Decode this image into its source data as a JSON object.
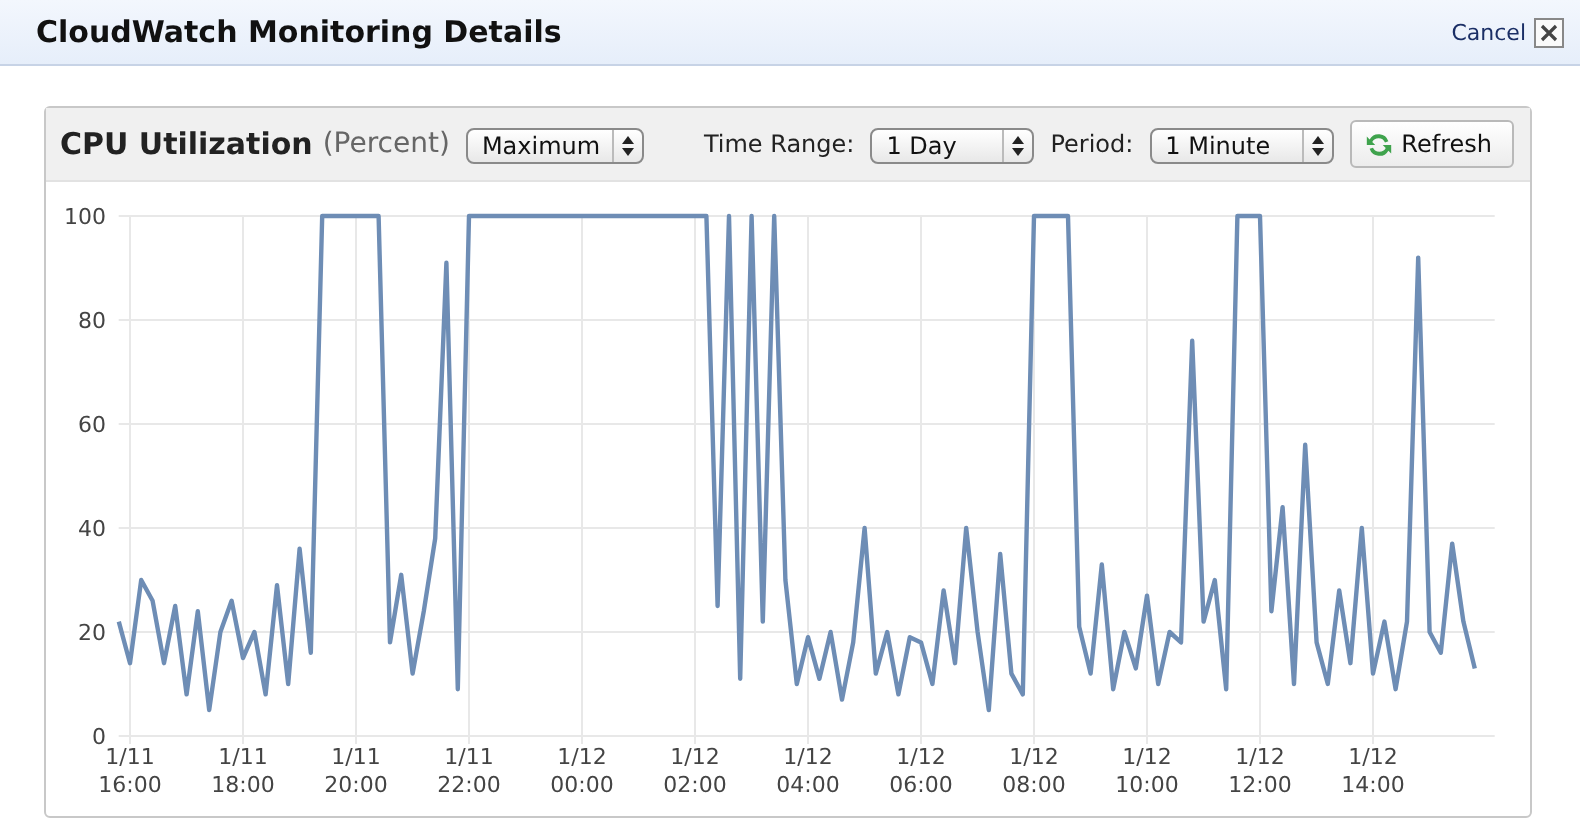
{
  "dialog": {
    "title": "CloudWatch Monitoring Details",
    "cancel_link": "Cancel"
  },
  "panel": {
    "metric": "CPU Utilization",
    "unit": "(Percent)",
    "statistic": "Maximum",
    "time_range_label": "Time Range:",
    "time_range": "1 Day",
    "period_label": "Period:",
    "period": "1 Minute",
    "refresh_button": "Refresh",
    "chart_data": {
      "type": "line",
      "categories": [
        null,
        "1/11 16:00",
        null,
        null,
        null,
        null,
        null,
        null,
        null,
        null,
        null,
        "1/11 18:00",
        null,
        null,
        null,
        null,
        null,
        null,
        null,
        null,
        null,
        "1/11 20:00",
        null,
        null,
        null,
        null,
        null,
        null,
        null,
        null,
        null,
        "1/11 22:00",
        null,
        null,
        null,
        null,
        null,
        null,
        null,
        null,
        null,
        "1/12 00:00",
        null,
        null,
        null,
        null,
        null,
        null,
        null,
        null,
        null,
        "1/12 02:00",
        null,
        null,
        null,
        null,
        null,
        null,
        null,
        null,
        null,
        "1/12 04:00",
        null,
        null,
        null,
        null,
        null,
        null,
        null,
        null,
        null,
        "1/12 06:00",
        null,
        null,
        null,
        null,
        null,
        null,
        null,
        null,
        null,
        "1/12 08:00",
        null,
        null,
        null,
        null,
        null,
        null,
        null,
        null,
        null,
        "1/12 10:00",
        null,
        null,
        null,
        null,
        null,
        null,
        null,
        null,
        null,
        "1/12 12:00",
        null,
        null,
        null,
        null,
        null,
        null,
        null,
        null,
        null,
        "1/12 14:00",
        null,
        null,
        null,
        null,
        null,
        null,
        null,
        null,
        null
      ],
      "series": [
        {
          "color": "#6e8db5",
          "values": [
            22,
            14,
            30,
            26,
            14,
            25,
            8,
            24,
            5,
            20,
            26,
            15,
            20,
            8,
            29,
            10,
            36,
            16,
            100,
            100,
            100,
            100,
            100,
            100,
            18,
            31,
            12,
            24,
            38,
            91,
            9,
            100,
            100,
            100,
            100,
            100,
            100,
            100,
            100,
            100,
            100,
            100,
            100,
            100,
            100,
            100,
            100,
            100,
            100,
            100,
            100,
            100,
            100,
            25,
            100,
            11,
            100,
            22,
            100,
            30,
            10,
            19,
            11,
            20,
            7,
            18,
            40,
            12,
            20,
            8,
            19,
            18,
            10,
            28,
            14,
            40,
            20,
            5,
            35,
            12,
            8,
            100,
            100,
            100,
            100,
            21,
            12,
            33,
            9,
            20,
            13,
            27,
            10,
            20,
            18,
            76,
            22,
            30,
            9,
            100,
            100,
            100,
            24,
            44,
            10,
            56,
            18,
            10,
            28,
            14,
            40,
            12,
            22,
            9,
            22,
            92,
            20,
            16,
            37,
            22,
            13
          ]
        }
      ],
      "grid": true,
      "ylim": [
        0,
        100
      ],
      "yticks": [
        0,
        20,
        40,
        60,
        80,
        100
      ]
    }
  }
}
